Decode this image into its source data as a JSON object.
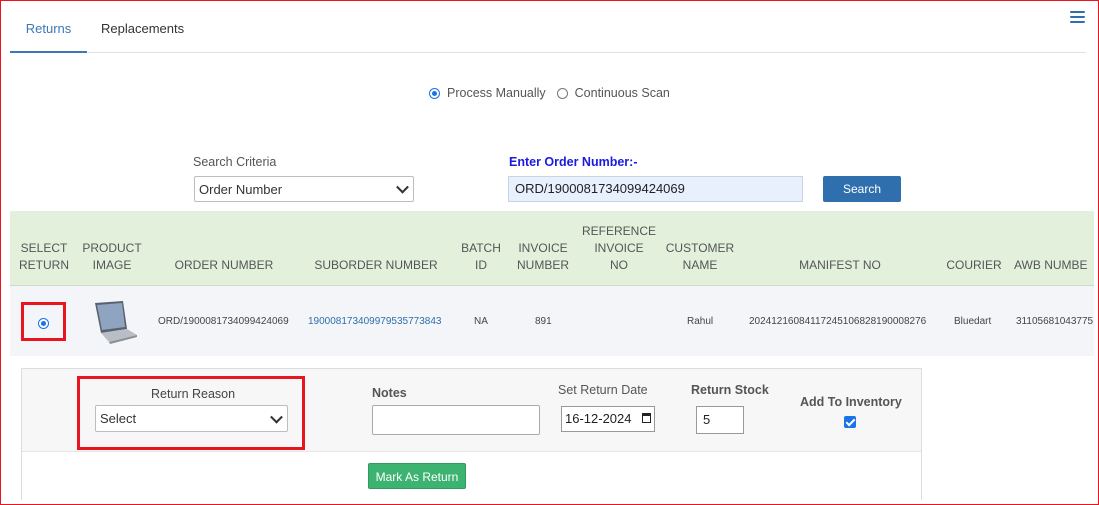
{
  "tabs": [
    {
      "label": "Returns",
      "active": true
    },
    {
      "label": "Replacements",
      "active": false
    }
  ],
  "mode": {
    "option1": "Process Manually",
    "option2": "Continuous Scan",
    "selected": "Process Manually"
  },
  "search": {
    "criteria_label": "Search Criteria",
    "criteria_value": "Order Number",
    "order_label": "Enter Order Number:-",
    "order_value": "ORD/1900081734099424069",
    "button_label": "Search"
  },
  "table": {
    "headers": {
      "select_return": [
        "SELECT",
        "RETURN"
      ],
      "product_image": [
        "PRODUCT",
        "IMAGE"
      ],
      "order_number": "ORDER NUMBER",
      "suborder_number": "SUBORDER NUMBER",
      "batch_id": [
        "BATCH",
        "ID"
      ],
      "invoice_number": [
        "INVOICE",
        "NUMBER"
      ],
      "reference_invoice_no": [
        "REFERENCE",
        "INVOICE",
        "NO"
      ],
      "customer_name": [
        "CUSTOMER",
        "NAME"
      ],
      "manifest_no": "MANIFEST NO",
      "courier": "COURIER",
      "awb_number": "AWB NUMBE"
    },
    "row": {
      "order_number": "ORD/1900081734099424069",
      "suborder_number": "19000817340997953577384 3",
      "suborder_number_display": "190008173409979535773843",
      "batch_id": "NA",
      "invoice_number": "891",
      "customer_name": "Rahul",
      "manifest_no": "20241216084117245106828190008276",
      "courier": "Bluedart",
      "awb_number": "31105681043775"
    }
  },
  "details": {
    "return_reason_label": "Return Reason",
    "return_reason_value": "Select",
    "notes_label": "Notes",
    "return_date_label": "Set Return Date",
    "return_date_value": "16-12-2024",
    "return_stock_label": "Return Stock",
    "return_stock_value": "5",
    "add_inventory_label": "Add To Inventory",
    "add_inventory_checked": true,
    "mark_button_label": "Mark As Return"
  },
  "colors": {
    "accent": "#2f6fae",
    "header_bg": "#e3f1dc",
    "highlight": "#e8141f",
    "success": "#3cb371"
  }
}
